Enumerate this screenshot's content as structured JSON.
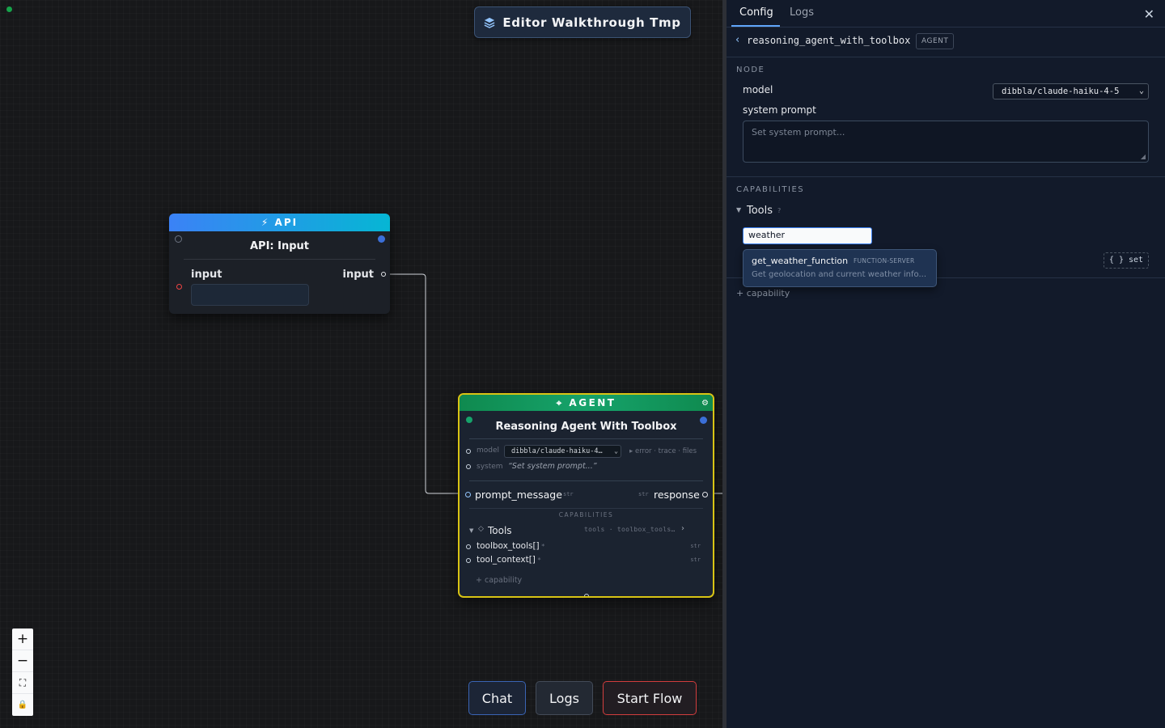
{
  "flow": {
    "title": "Editor Walkthrough Tmp"
  },
  "api_node": {
    "header": "⚡ API",
    "title": "API: Input",
    "input_label": "input",
    "output_label": "input"
  },
  "agent_node": {
    "header": "⌖ AGENT",
    "gear": "⚙",
    "title": "Reasoning Agent With Toolbox",
    "model_label": "model",
    "model_value": "dibbla/claude-haiku-4…",
    "meta": "▸ error · trace · files",
    "system_label": "system",
    "system_value": "“Set system prompt...”",
    "input_port": "prompt_message",
    "input_type": "str",
    "output_port": "response",
    "output_type": "str",
    "capabilities_heading": "CAPABILITIES",
    "tools_label": "Tools",
    "tools_meta": "tools · toolbox_tools…",
    "tools_chevron": "›",
    "fields": [
      {
        "label": "toolbox_tools[]",
        "type": "str"
      },
      {
        "label": "tool_context[]",
        "type": "str"
      }
    ],
    "add_capability": "+ capability"
  },
  "zoom": {
    "zoom_in": "+",
    "zoom_out": "−",
    "fit": "⛶",
    "lock": "🔒"
  },
  "bottom_buttons": {
    "chat": "Chat",
    "logs": "Logs",
    "start": "Start Flow"
  },
  "panel": {
    "tabs": [
      "Config",
      "Logs"
    ],
    "close": "✕",
    "breadcrumb": {
      "back": "‹",
      "name": "reasoning_agent_with_toolbox",
      "badge": "AGENT"
    },
    "node_section": "NODE",
    "model_label": "model",
    "model_value": "dibbla/claude-haiku-4-5",
    "system_prompt_label": "system prompt",
    "system_prompt_placeholder": "Set system prompt...",
    "capabilities_section": "CAPABILITIES",
    "tools_label": "Tools",
    "tools_help": "?",
    "tools_search_value": "weather",
    "set_button": "{ } set",
    "add_capability": "+ capability",
    "dropdown": {
      "name": "get_weather_function",
      "tag": "FUNCTION-SERVER",
      "description": "Get geolocation and current weather info..."
    }
  },
  "colors": {
    "accent": "#3b82f6",
    "selection": "#d8c414",
    "start_border": "#d13d3d",
    "agent_header": "#16a36b"
  }
}
